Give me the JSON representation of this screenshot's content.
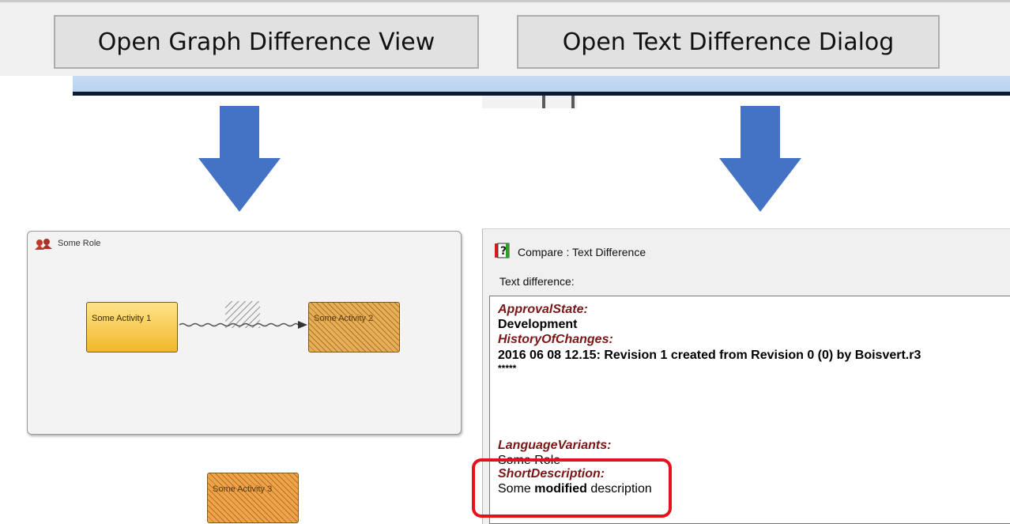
{
  "toolbar": {
    "graph_button": "Open Graph Difference View",
    "text_button": "Open Text Difference Dialog"
  },
  "colors": {
    "arrow": "#4472c4",
    "highlight": "#e8101a",
    "field_name": "#7a1616"
  },
  "graph_view": {
    "role_label": "Some Role",
    "activities": [
      "Some Activity 1",
      "Some Activity 2",
      "Some Activity 3"
    ]
  },
  "text_dialog": {
    "title": "Compare : Text Difference",
    "label": "Text difference:",
    "fields": [
      {
        "name": "ApprovalState:",
        "value": "Development"
      },
      {
        "name": "HistoryOfChanges:",
        "value": "2016 06 08 12.15: Revision 1 created from Revision 0 (0) by Boisvert.r3",
        "value2": "*****"
      },
      {
        "name": "LanguageVariants:",
        "value": "Some Role"
      },
      {
        "name": "ShortDescription:",
        "value_parts": [
          "Some",
          "modified",
          "description"
        ]
      }
    ]
  }
}
